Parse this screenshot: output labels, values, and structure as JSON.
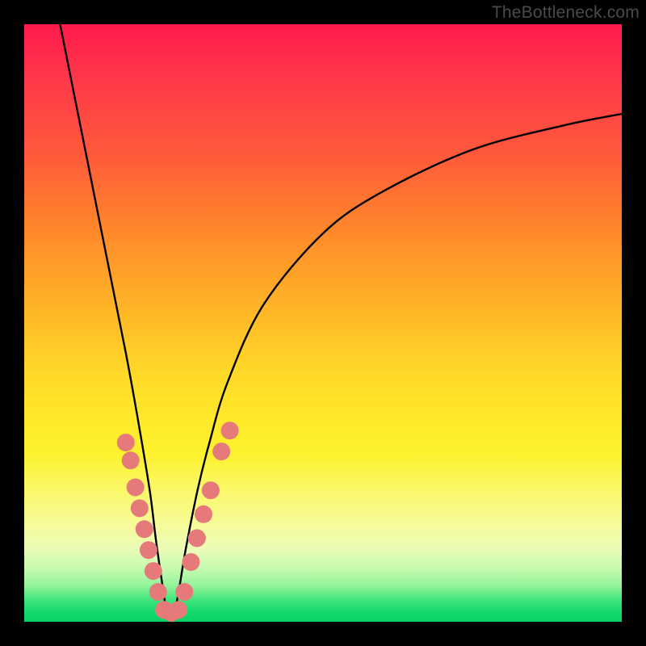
{
  "watermark": "TheBottleneck.com",
  "chart_data": {
    "type": "line",
    "title": "",
    "xlabel": "",
    "ylabel": "",
    "xlim": [
      0,
      100
    ],
    "ylim": [
      0,
      100
    ],
    "curve": {
      "description": "V-shaped bottleneck curve; minimum near x≈24, left branch steep, right branch shallow",
      "x": [
        6,
        10,
        14,
        17,
        19,
        21,
        22,
        23,
        24,
        25,
        26,
        27,
        29,
        31,
        34,
        40,
        50,
        60,
        75,
        90,
        100
      ],
      "y": [
        100,
        80,
        60,
        45,
        34,
        22,
        14,
        7,
        1,
        1,
        6,
        12,
        22,
        30,
        40,
        53,
        65,
        72,
        79,
        83,
        85
      ]
    },
    "markers": {
      "description": "salmon circular data-point markers clustered near the curve minimum",
      "color": "#e67a7a",
      "radius_px": 11,
      "points": [
        {
          "x": 17.0,
          "y": 30.0
        },
        {
          "x": 17.8,
          "y": 27.0
        },
        {
          "x": 18.6,
          "y": 22.5
        },
        {
          "x": 19.3,
          "y": 19.0
        },
        {
          "x": 20.1,
          "y": 15.5
        },
        {
          "x": 20.8,
          "y": 12.0
        },
        {
          "x": 21.6,
          "y": 8.5
        },
        {
          "x": 22.4,
          "y": 5.0
        },
        {
          "x": 23.4,
          "y": 2.0
        },
        {
          "x": 24.6,
          "y": 1.5
        },
        {
          "x": 25.8,
          "y": 2.0
        },
        {
          "x": 26.8,
          "y": 5.0
        },
        {
          "x": 27.9,
          "y": 10.0
        },
        {
          "x": 28.9,
          "y": 14.0
        },
        {
          "x": 30.0,
          "y": 18.0
        },
        {
          "x": 31.2,
          "y": 22.0
        },
        {
          "x": 33.0,
          "y": 28.5
        },
        {
          "x": 34.4,
          "y": 32.0
        }
      ]
    }
  }
}
